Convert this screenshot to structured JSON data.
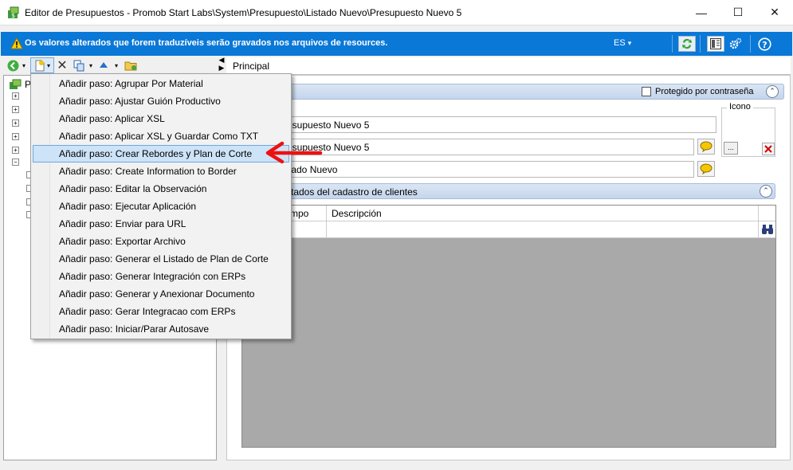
{
  "window": {
    "title": "Editor de Presupuestos - Promob Start Labs\\System\\Presupuesto\\Listado Nuevo\\Presupuesto Nuevo 5",
    "minimize": "—",
    "maximize": "☐",
    "close": "✕"
  },
  "banner": {
    "message": "Os valores alterados que forem traduzíveis serão gravados nos arquivos de resources.",
    "language": "ES",
    "language_caret": "▾",
    "color": "#0a78d7"
  },
  "tree": {
    "root_label": "P"
  },
  "tabs": {
    "principal": "Principal"
  },
  "form": {
    "protected_label": "Protegido por contraseña",
    "icon_label": "Icono",
    "icon_browse": "...",
    "field1": "resupuesto Nuevo 5",
    "field2": "resupuesto Nuevo 5",
    "field3": "stado Nuevo",
    "clients_group_title": "licitados del cadastro de clientes",
    "col_campo": "mpo",
    "col_descripcion": "Descripción"
  },
  "menu": {
    "items": [
      "Añadir paso: Agrupar Por Material",
      "Añadir paso: Ajustar Guión Productivo",
      "Añadir paso: Aplicar XSL",
      "Añadir paso: Aplicar XSL y Guardar Como TXT",
      "Añadir paso: Crear Rebordes y Plan de Corte",
      "Añadir paso: Create Information to Border",
      "Añadir paso: Editar la Observación",
      "Añadir paso: Ejecutar Aplicación",
      "Añadir paso: Enviar para URL",
      "Añadir paso: Exportar Archivo",
      "Añadir paso: Generar el Listado de Plan de Corte",
      "Añadir paso: Generar Integración con ERPs",
      "Añadir paso: Generar y Anexionar Documento",
      "Añadir paso: Gerar Integracao com ERPs",
      "Añadir paso: Iniciar/Parar Autosave"
    ],
    "highlighted_index": 4
  }
}
